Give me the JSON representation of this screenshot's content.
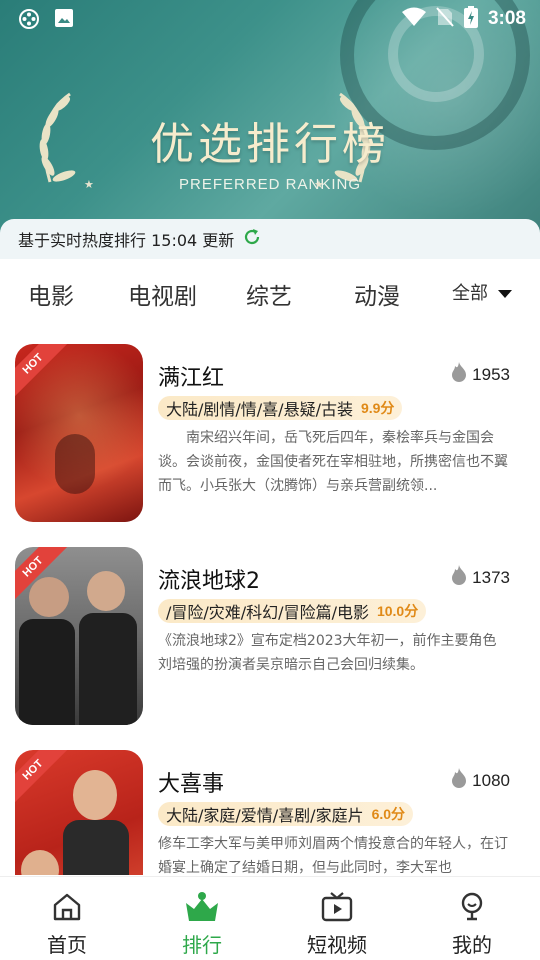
{
  "status_bar": {
    "time": "3:08"
  },
  "hero": {
    "title": "优选排行榜",
    "subtitle": "PREFERRED RANKING"
  },
  "update_bar": {
    "text": "基于实时热度排行 15:04 更新"
  },
  "tabs": [
    {
      "label": "电影"
    },
    {
      "label": "电视剧"
    },
    {
      "label": "综艺"
    },
    {
      "label": "动漫"
    }
  ],
  "filter": {
    "label": "全部"
  },
  "hot_badge": "HOT",
  "items": [
    {
      "title": "满江红",
      "heat": "1953",
      "tags": "大陆/剧情/情/喜/悬疑/古装",
      "score": "9.9分",
      "desc": "南宋绍兴年间，岳飞死后四年，秦桧率兵与金国会谈。会谈前夜，金国使者死在宰相驻地，所携密信也不翼而飞。小兵张大（沈腾饰）与亲兵营副统领..."
    },
    {
      "title": "流浪地球2",
      "heat": "1373",
      "tags": "/冒险/灾难/科幻/冒险篇/电影",
      "score": "10.0分",
      "desc": "《流浪地球2》宣布定档2023大年初一，前作主要角色刘培强的扮演者吴京暗示自己会回归续集。"
    },
    {
      "title": "大喜事",
      "heat": "1080",
      "tags": "大陆/家庭/爱情/喜剧/家庭片",
      "score": "6.0分",
      "desc": "修车工李大军与美甲师刘眉两个情投意合的年轻人，在订婚宴上确定了结婚日期，但与此同时，李大军也"
    }
  ],
  "nav": [
    {
      "label": "首页"
    },
    {
      "label": "排行"
    },
    {
      "label": "短视频"
    },
    {
      "label": "我的"
    }
  ],
  "colors": {
    "accent_green": "#2ea84a",
    "score_orange": "#e08a18",
    "hot_red": "#e2423b"
  }
}
